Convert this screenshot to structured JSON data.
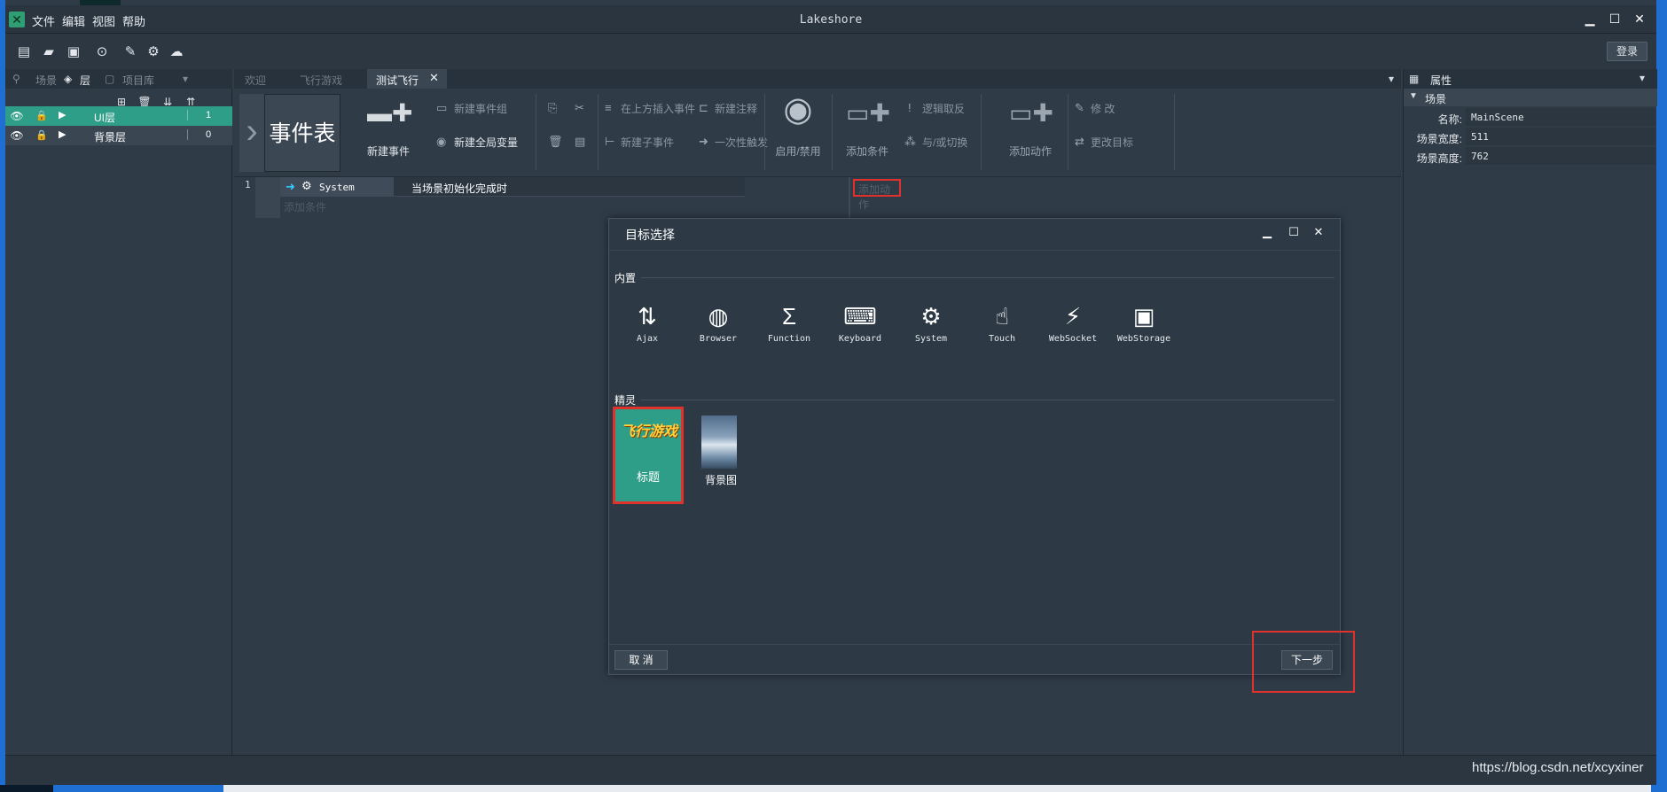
{
  "window": {
    "title": "Lakeshore",
    "menu": [
      "文件",
      "编辑",
      "视图",
      "帮助"
    ],
    "login": "登录"
  },
  "toolbar": {
    "icons": [
      "new-file-icon",
      "open-folder-icon",
      "save-icon",
      "play-icon",
      "brush-icon",
      "robot-icon",
      "cloud-upload-icon"
    ]
  },
  "left_panel": {
    "tabs": [
      "场景",
      "层",
      "项目库"
    ],
    "layers": [
      {
        "name": "UI层",
        "count": "1",
        "selected": true
      },
      {
        "name": "背景层",
        "count": "0",
        "selected": false
      }
    ]
  },
  "doc_tabs": [
    "欢迎",
    "飞行游戏",
    "测试飞行"
  ],
  "ribbon": {
    "title": "事件表",
    "new_event": "新建事件",
    "new_event_group": "新建事件组",
    "new_global_var": "新建全局变量",
    "insert_above": "在上方插入事件",
    "new_comment": "新建注释",
    "new_sub_event": "新建子事件",
    "trigger_once": "一次性触发",
    "enable_disable": "启用/禁用",
    "add_condition": "添加条件",
    "logic_invert": "逻辑取反",
    "and_or": "与/或切换",
    "add_action": "添加动作",
    "modify": "修 改",
    "change_target": "更改目标"
  },
  "event_table": {
    "row_number": "1",
    "object": "System",
    "condition": "当场景初始化完成时",
    "add_condition": "添加条件",
    "add_action": "添加动作"
  },
  "right_panel": {
    "header": "属性",
    "section": "场景",
    "props": [
      {
        "label": "名称:",
        "value": "MainScene"
      },
      {
        "label": "场景宽度:",
        "value": "511"
      },
      {
        "label": "场景高度:",
        "value": "762"
      }
    ]
  },
  "dialog": {
    "title": "目标选择",
    "section_builtin": "内置",
    "builtin": [
      {
        "label": "Ajax",
        "icon": "ajax-icon"
      },
      {
        "label": "Browser",
        "icon": "globe-icon"
      },
      {
        "label": "Function",
        "icon": "sigma-icon"
      },
      {
        "label": "Keyboard",
        "icon": "keyboard-icon"
      },
      {
        "label": "System",
        "icon": "gears-icon"
      },
      {
        "label": "Touch",
        "icon": "touch-icon"
      },
      {
        "label": "WebSocket",
        "icon": "websocket-icon"
      },
      {
        "label": "WebStorage",
        "icon": "floppy-icon"
      }
    ],
    "section_sprite": "精灵",
    "sprites": [
      {
        "label": "标题",
        "image_text": "飞行游戏"
      },
      {
        "label": "背景图"
      }
    ],
    "cancel": "取 消",
    "next": "下一步"
  },
  "watermark": "https://blog.csdn.net/xcyxiner",
  "colors": {
    "accent": "#2f9e88",
    "highlight": "#e0312a",
    "panel": "#2f3b47"
  }
}
